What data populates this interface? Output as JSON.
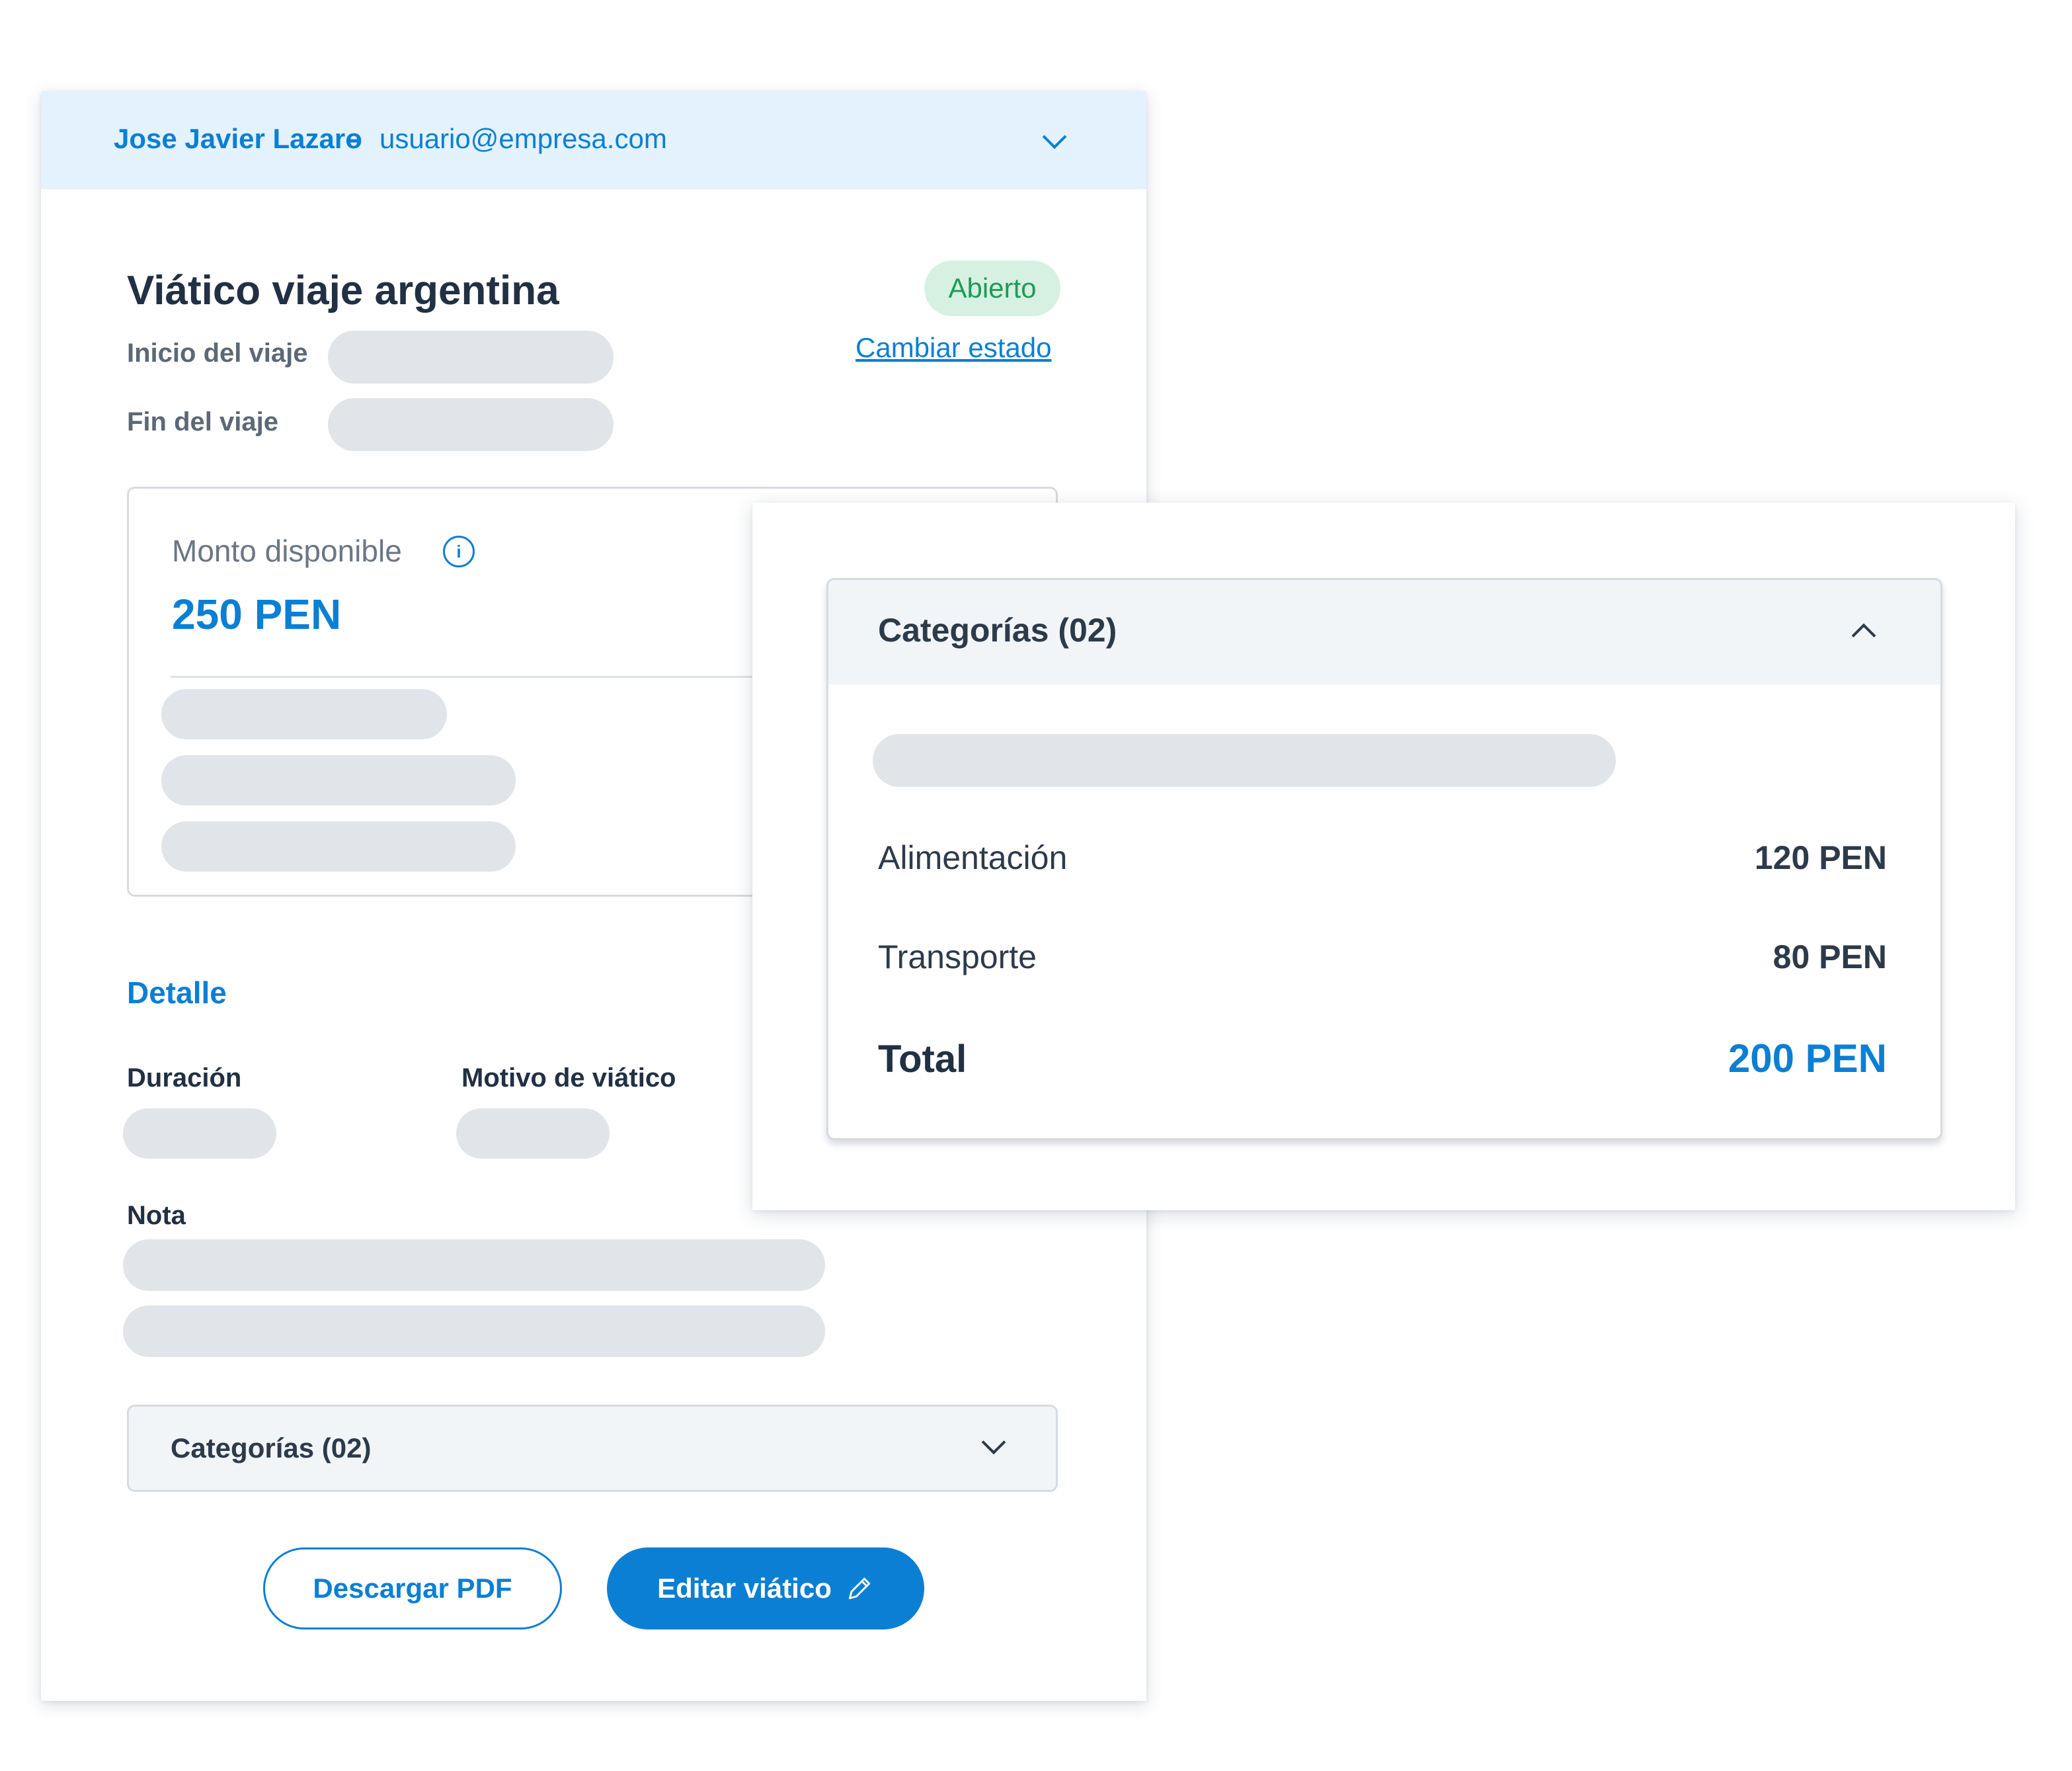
{
  "header": {
    "user_name": "Jose Javier Lazaro",
    "separator": "-",
    "user_email": "usuario@empresa.com",
    "dropdown_icon": "chevron-down-icon"
  },
  "viatico": {
    "title": "Viático viaje argentina",
    "status": "Abierto",
    "change_status_label": "Cambiar estado",
    "start_label": "Inicio del viaje",
    "end_label": "Fin del viaje"
  },
  "monto": {
    "label": "Monto disponible",
    "info_icon": "info-icon",
    "value": "250 PEN"
  },
  "detalle": {
    "title": "Detalle",
    "duracion_label": "Duración",
    "motivo_label": "Motivo de viático",
    "nota_label": "Nota"
  },
  "categorias_collapsed": {
    "label": "Categorías (02)"
  },
  "actions": {
    "download_label": "Descargar PDF",
    "edit_label": "Editar viático",
    "edit_icon": "pencil-icon"
  },
  "categorias_expanded": {
    "title": "Categorías (02)",
    "toggle_icon": "chevron-up-icon",
    "items": [
      {
        "label": "Alimentación",
        "value": "120 PEN"
      },
      {
        "label": "Transporte",
        "value": "80 PEN"
      }
    ],
    "total_label": "Total",
    "total_value": "200 PEN"
  },
  "colors": {
    "primary": "#0b7fd4",
    "header_bg": "#e3f2fd",
    "badge_bg": "#d6f1e2",
    "badge_text": "#1f9a5a",
    "skeleton": "#e1e4e8"
  }
}
